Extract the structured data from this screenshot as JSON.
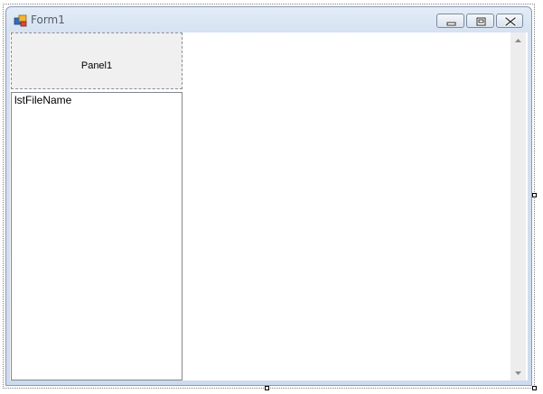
{
  "window": {
    "title": "Form1",
    "icon": "form-icon",
    "buttons": [
      "minimize-icon",
      "maximize-icon",
      "close-icon"
    ]
  },
  "panel1": {
    "label": "Panel1"
  },
  "listbox": {
    "label": "lstFileName"
  },
  "scrollbar": {
    "up_icon": "scroll-up-icon",
    "down_icon": "scroll-down-icon"
  },
  "colors": {
    "title_bar": "#d6e2f1",
    "panel_background": "#f0f0f0",
    "client_background": "#ffffff"
  }
}
